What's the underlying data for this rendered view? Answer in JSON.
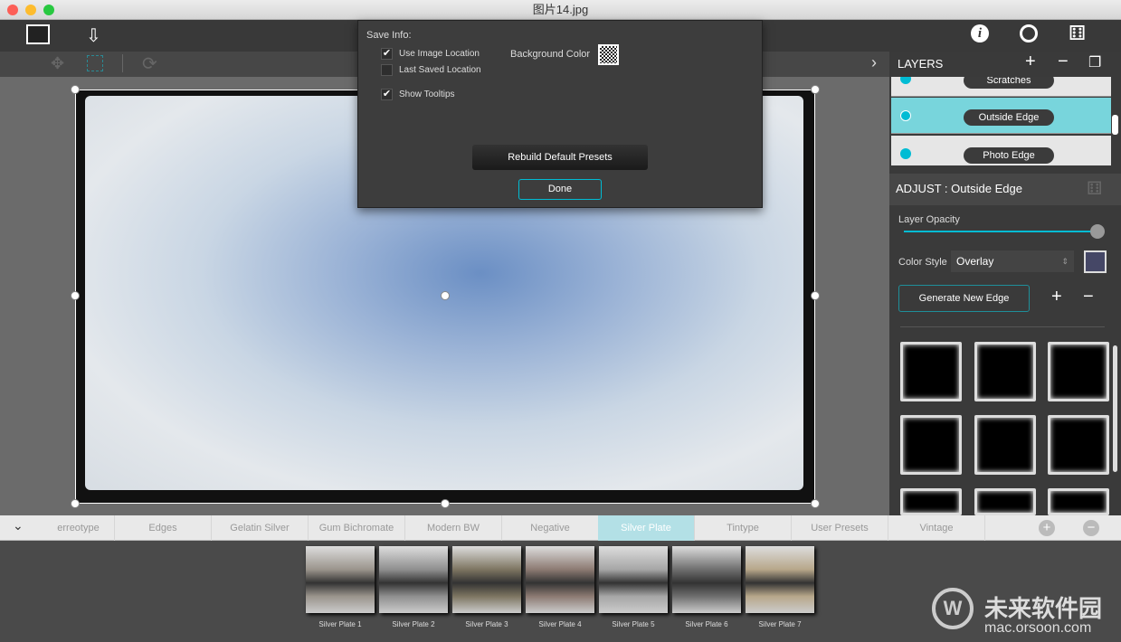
{
  "window": {
    "title": "图片14.jpg"
  },
  "dialog": {
    "heading": "Save Info:",
    "use_image_location": "Use Image Location",
    "use_image_location_checked": true,
    "last_saved_location": "Last Saved Location",
    "last_saved_location_checked": false,
    "show_tooltips": "Show Tooltips",
    "show_tooltips_checked": true,
    "background_color": "Background Color",
    "rebuild": "Rebuild Default Presets",
    "done": "Done"
  },
  "layers": {
    "title": "LAYERS",
    "items": [
      {
        "label": "Scratches"
      },
      {
        "label": "Outside Edge",
        "selected": true
      },
      {
        "label": "Photo Edge"
      }
    ]
  },
  "adjust": {
    "title": "ADJUST : Outside Edge",
    "opacity_label": "Layer Opacity",
    "opacity_value": 100,
    "color_style_label": "Color Style",
    "color_style_value": "Overlay",
    "color_swatch": "#454766",
    "generate": "Generate New Edge"
  },
  "tabs": [
    "erreotype",
    "Edges",
    "Gelatin Silver",
    "Gum Bichromate",
    "Modern BW",
    "Negative",
    "Silver Plate",
    "Tintype",
    "User Presets",
    "Vintage"
  ],
  "active_tab": "Silver Plate",
  "presets": [
    "Silver Plate 1",
    "Silver Plate 2",
    "Silver Plate 3",
    "Silver Plate 4",
    "Silver Plate 5",
    "Silver Plate 6",
    "Silver Plate 7"
  ],
  "watermark": {
    "name": "未来软件园",
    "url": "mac.orsoon.com"
  },
  "colors": {
    "accent": "#00bcd4",
    "active_tab": "#b3e0e6"
  }
}
